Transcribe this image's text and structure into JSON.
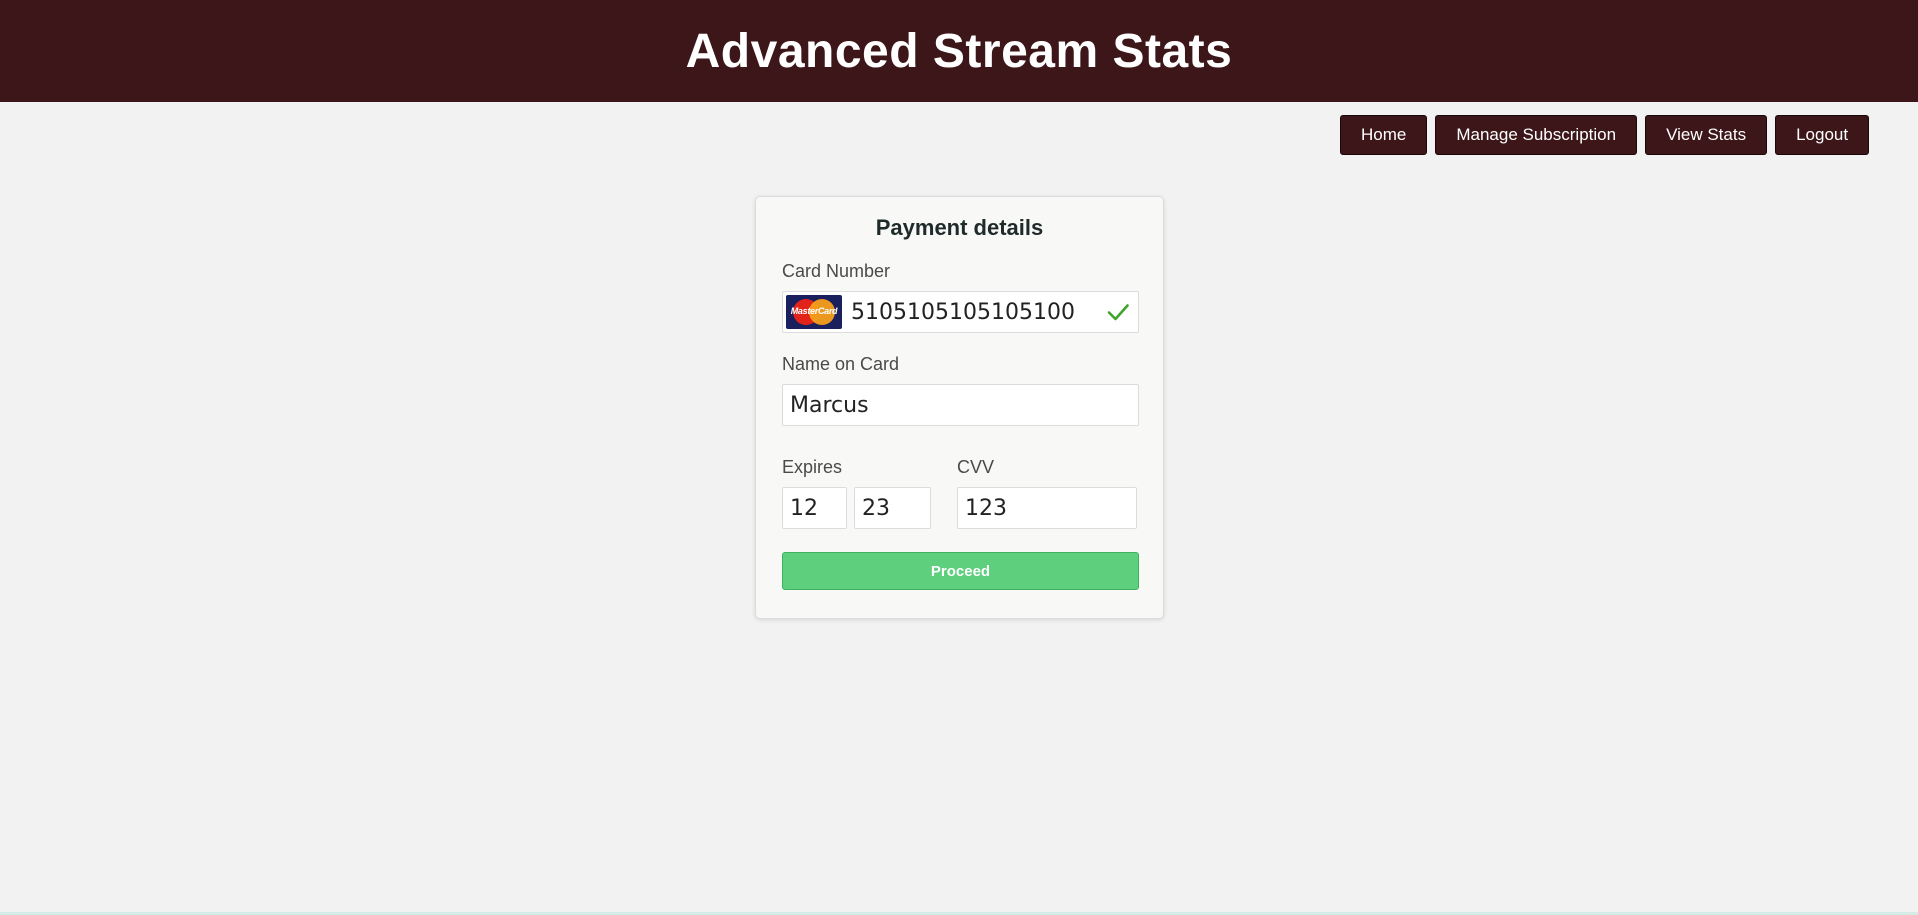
{
  "header": {
    "title": "Advanced Stream Stats"
  },
  "nav": {
    "items": [
      {
        "label": "Home"
      },
      {
        "label": "Manage Subscription"
      },
      {
        "label": "View Stats"
      },
      {
        "label": "Logout"
      }
    ]
  },
  "payment": {
    "title": "Payment details",
    "card_number_label": "Card Number",
    "card_number_value": "5105105105105100",
    "card_brand_logo_text": "MasterCard",
    "card_brand_icon": "mastercard-logo-icon",
    "valid_icon": "checkmark-icon",
    "name_label": "Name on Card",
    "name_value": "Marcus",
    "expires_label": "Expires",
    "expires_month": "12",
    "expires_year": "23",
    "cvv_label": "CVV",
    "cvv_value": "123",
    "proceed_label": "Proceed"
  },
  "colors": {
    "header_bg": "#3c1618",
    "page_bg": "#f2f2f2",
    "proceed_bg": "#5dcf7d",
    "check": "#3fa32d"
  }
}
